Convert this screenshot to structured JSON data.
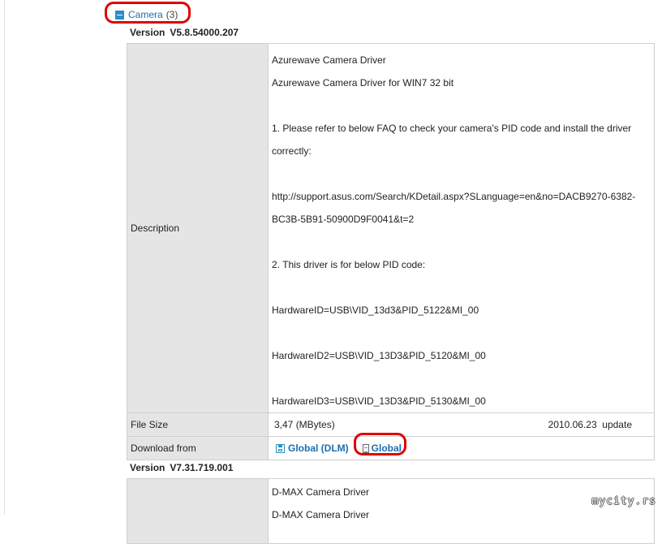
{
  "category": {
    "name": "Camera",
    "count": "(3)"
  },
  "driver1": {
    "version_label": "Version",
    "version": "V5.8.54000.207",
    "description_label": "Description",
    "description_lines": [
      "Azurewave Camera Driver",
      "Azurewave Camera Driver for WIN7 32 bit",
      "",
      "1. Please refer to below FAQ to check your camera's PID code and install the driver",
      "correctly:",
      "",
      "http://support.asus.com/Search/KDetail.aspx?SLanguage=en&no=DACB9270-6382-",
      "BC3B-5B91-50900D9F0041&t=2",
      "",
      "2. This driver is for below PID code:",
      "",
      "HardwareID=USB\\VID_13d3&PID_5122&MI_00",
      "",
      "HardwareID2=USB\\VID_13D3&PID_5120&MI_00",
      "",
      "HardwareID3=USB\\VID_13D3&PID_5130&MI_00"
    ],
    "file_size_label": "File Size",
    "file_size": "3,47 (MBytes)",
    "update": "2010.06.23  update",
    "download_label": "Download from",
    "dl_option_1": "Global (DLM)",
    "dl_option_2": "Global"
  },
  "driver2": {
    "version_label": "Version",
    "version": "V7.31.719.001",
    "description_lines": [
      "D-MAX Camera Driver",
      "D-MAX Camera Driver"
    ]
  },
  "watermark": "mycity.rs",
  "colors": {
    "highlight_ring": "#e10000",
    "link": "#1a6fb0",
    "label_bg": "#e5e5e5"
  }
}
